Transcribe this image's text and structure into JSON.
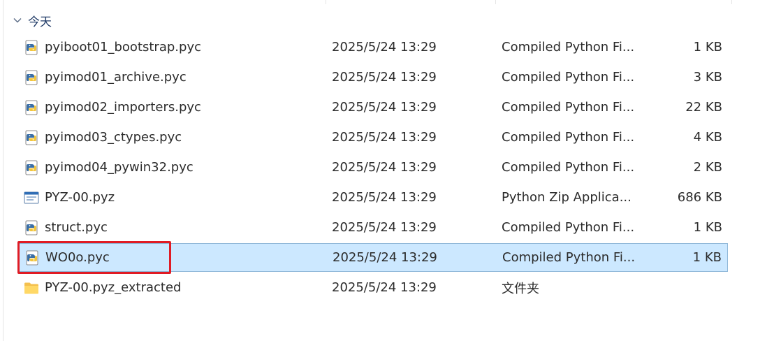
{
  "group": {
    "label": "今天"
  },
  "files": [
    {
      "name": "pyiboot01_bootstrap.pyc",
      "date": "2025/5/24 13:29",
      "type": "Compiled Python Fi...",
      "size": "1 KB",
      "icon": "pyc-icon"
    },
    {
      "name": "pyimod01_archive.pyc",
      "date": "2025/5/24 13:29",
      "type": "Compiled Python Fi...",
      "size": "3 KB",
      "icon": "pyc-icon"
    },
    {
      "name": "pyimod02_importers.pyc",
      "date": "2025/5/24 13:29",
      "type": "Compiled Python Fi...",
      "size": "22 KB",
      "icon": "pyc-icon"
    },
    {
      "name": "pyimod03_ctypes.pyc",
      "date": "2025/5/24 13:29",
      "type": "Compiled Python Fi...",
      "size": "4 KB",
      "icon": "pyc-icon"
    },
    {
      "name": "pyimod04_pywin32.pyc",
      "date": "2025/5/24 13:29",
      "type": "Compiled Python Fi...",
      "size": "2 KB",
      "icon": "pyc-icon"
    },
    {
      "name": "PYZ-00.pyz",
      "date": "2025/5/24 13:29",
      "type": "Python Zip Applica...",
      "size": "686 KB",
      "icon": "pyz-icon"
    },
    {
      "name": "struct.pyc",
      "date": "2025/5/24 13:29",
      "type": "Compiled Python Fi...",
      "size": "1 KB",
      "icon": "pyc-icon"
    },
    {
      "name": "WO0o.pyc",
      "date": "2025/5/24 13:29",
      "type": "Compiled Python Fi...",
      "size": "1 KB",
      "icon": "pyc-icon",
      "selected": true,
      "highlighted": true
    },
    {
      "name": "PYZ-00.pyz_extracted",
      "date": "2025/5/24 13:29",
      "type": "文件夹",
      "size": "",
      "icon": "folder-icon"
    }
  ],
  "colors": {
    "selection": "#cce8ff",
    "highlight_box": "#e01b24",
    "group_header": "#1f3a66"
  }
}
